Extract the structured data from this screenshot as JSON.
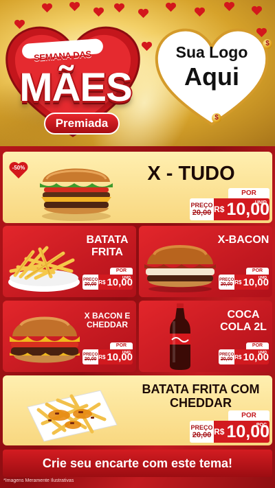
{
  "header": {
    "title_top": "SEMANA DAS",
    "title_main": "MÃES",
    "title_badge": "Premiada",
    "brand_line1": "Sua Logo",
    "brand_line2": "Aqui",
    "coin_symbol": "$"
  },
  "colors": {
    "brand_red": "#d21a1f",
    "dark_red": "#8c0d11",
    "gold": "#f3d067",
    "cream": "#ffefb0"
  },
  "products": [
    {
      "name": "X - TUDO",
      "por": "POR",
      "preco": "PREÇO",
      "de": "de",
      "old": "20,00",
      "currency": "R$",
      "price": "10,00",
      "unit": "UNID",
      "badge": "-50%",
      "image": "burger-icon"
    },
    {
      "name": "BATATA FRITA",
      "por": "POR",
      "preco": "PREÇO",
      "de": "de",
      "old": "20,00",
      "currency": "R$",
      "price": "10,00",
      "unit": "UNID",
      "image": "fries-icon"
    },
    {
      "name": "X-BACON",
      "por": "POR",
      "preco": "PREÇO",
      "de": "de",
      "old": "20,00",
      "currency": "R$",
      "price": "10,00",
      "unit": "UNID",
      "image": "bacon-burger-icon"
    },
    {
      "name": "X BACON E CHEDDAR",
      "por": "POR",
      "preco": "PREÇO",
      "de": "de",
      "old": "20,00",
      "currency": "R$",
      "price": "10,00",
      "unit": "UNID",
      "image": "cheddar-burger-icon"
    },
    {
      "name": "COCA COLA 2L",
      "por": "POR",
      "preco": "PREÇO",
      "de": "de",
      "old": "20,00",
      "currency": "R$",
      "price": "10,00",
      "unit": "UNID",
      "image": "soda-bottle-icon"
    },
    {
      "name": "BATATA FRITA COM CHEDDAR",
      "por": "POR",
      "preco": "PREÇO",
      "de": "de",
      "old": "20,00",
      "currency": "R$",
      "price": "10,00",
      "unit": "POÇ",
      "image": "cheddar-fries-icon"
    }
  ],
  "footer": {
    "cta": "Crie seu encarte com este tema!",
    "disclaimer": "*Imagens Meramente Ilustrativas"
  }
}
